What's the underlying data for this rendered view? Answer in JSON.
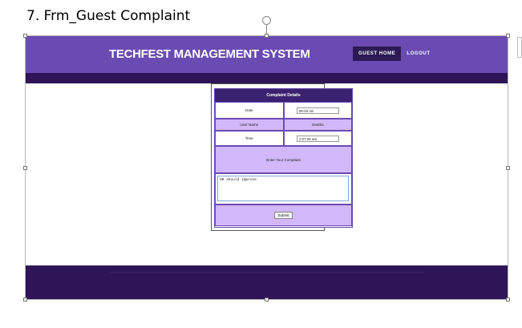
{
  "document": {
    "caption": "7. Frm_Guest Complaint"
  },
  "header": {
    "site_title": "TECHFEST MANAGEMENT SYSTEM",
    "nav": [
      {
        "label": "GUEST HOME",
        "active": true
      },
      {
        "label": "LOGOUT",
        "active": false
      }
    ]
  },
  "form": {
    "title": "Complaint Details",
    "date_label": "Date",
    "date_value": "05-04-16",
    "user_label": "User Name",
    "user_value": "Geetha",
    "time_label": "Time",
    "time_value": "1:07:25 am",
    "complaint_prompt": "Enter Your Complaint",
    "complaint_text": "HR should improve",
    "submit_label": "Submit"
  },
  "colors": {
    "header": "#6a4bb1",
    "dark_band": "#2f1558",
    "form_purple": "#d2b8f8"
  }
}
